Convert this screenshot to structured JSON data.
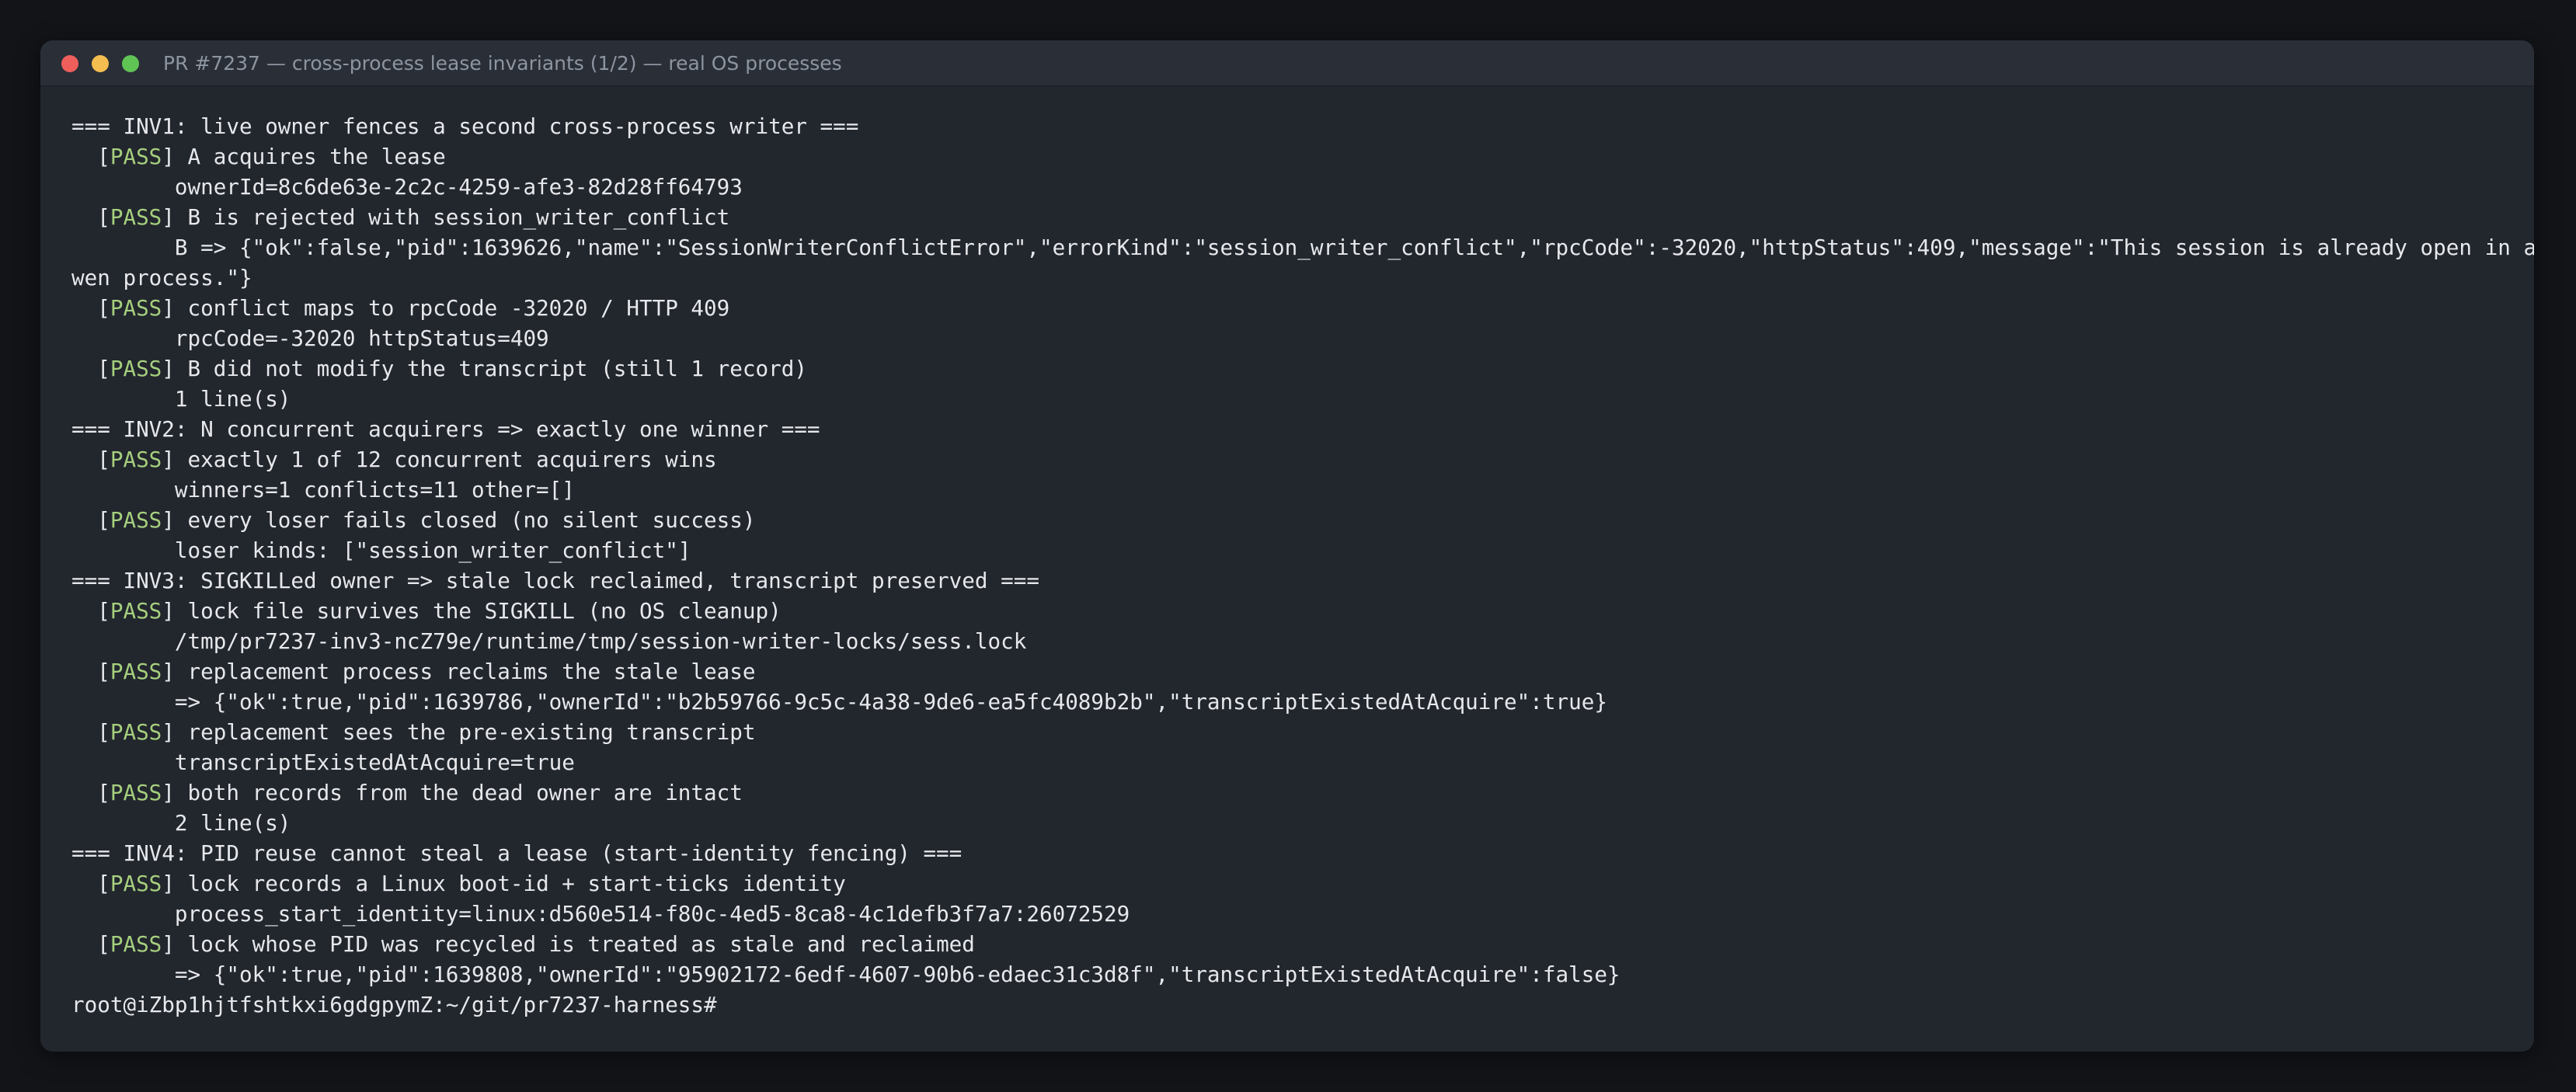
{
  "window": {
    "title": "PR #7237 — cross-process lease invariants (1/2) — real OS processes",
    "colors": {
      "background": "#121418",
      "terminal_bg": "#22262d",
      "titlebar_bg": "#2a2f37",
      "text": "#e6e8eb",
      "pass": "#a6cf7e",
      "traffic_red": "#ee5f5b",
      "traffic_yellow": "#f4bd4f",
      "traffic_green": "#5fc454"
    }
  },
  "terminal": {
    "lines": [
      {
        "text": "=== INV1: live owner fences a second cross-process writer ==="
      },
      {
        "prefix": "  [",
        "status": "PASS",
        "text": "] A acquires the lease"
      },
      {
        "text": "        ownerId=8c6de63e-2c2c-4259-afe3-82d28ff64793"
      },
      {
        "prefix": "  [",
        "status": "PASS",
        "text": "] B is rejected with session_writer_conflict"
      },
      {
        "text": "        B => {\"ok\":false,\"pid\":1639626,\"name\":\"SessionWriterConflictError\",\"errorKind\":\"session_writer_conflict\",\"rpcCode\":-32020,\"httpStatus\":409,\"message\":\"This session is already open in another Q"
      },
      {
        "text": "wen process.\"}"
      },
      {
        "prefix": "  [",
        "status": "PASS",
        "text": "] conflict maps to rpcCode -32020 / HTTP 409"
      },
      {
        "text": "        rpcCode=-32020 httpStatus=409"
      },
      {
        "prefix": "  [",
        "status": "PASS",
        "text": "] B did not modify the transcript (still 1 record)"
      },
      {
        "text": "        1 line(s)"
      },
      {
        "text": "=== INV2: N concurrent acquirers => exactly one winner ==="
      },
      {
        "prefix": "  [",
        "status": "PASS",
        "text": "] exactly 1 of 12 concurrent acquirers wins"
      },
      {
        "text": "        winners=1 conflicts=11 other=[]"
      },
      {
        "prefix": "  [",
        "status": "PASS",
        "text": "] every loser fails closed (no silent success)"
      },
      {
        "text": "        loser kinds: [\"session_writer_conflict\"]"
      },
      {
        "text": "=== INV3: SIGKILLed owner => stale lock reclaimed, transcript preserved ==="
      },
      {
        "prefix": "  [",
        "status": "PASS",
        "text": "] lock file survives the SIGKILL (no OS cleanup)"
      },
      {
        "text": "        /tmp/pr7237-inv3-ncZ79e/runtime/tmp/session-writer-locks/sess.lock"
      },
      {
        "prefix": "  [",
        "status": "PASS",
        "text": "] replacement process reclaims the stale lease"
      },
      {
        "text": "        => {\"ok\":true,\"pid\":1639786,\"ownerId\":\"b2b59766-9c5c-4a38-9de6-ea5fc4089b2b\",\"transcriptExistedAtAcquire\":true}"
      },
      {
        "prefix": "  [",
        "status": "PASS",
        "text": "] replacement sees the pre-existing transcript"
      },
      {
        "text": "        transcriptExistedAtAcquire=true"
      },
      {
        "prefix": "  [",
        "status": "PASS",
        "text": "] both records from the dead owner are intact"
      },
      {
        "text": "        2 line(s)"
      },
      {
        "text": "=== INV4: PID reuse cannot steal a lease (start-identity fencing) ==="
      },
      {
        "prefix": "  [",
        "status": "PASS",
        "text": "] lock records a Linux boot-id + start-ticks identity"
      },
      {
        "text": "        process_start_identity=linux:d560e514-f80c-4ed5-8ca8-4c1defb3f7a7:26072529"
      },
      {
        "prefix": "  [",
        "status": "PASS",
        "text": "] lock whose PID was recycled is treated as stale and reclaimed"
      },
      {
        "text": "        => {\"ok\":true,\"pid\":1639808,\"ownerId\":\"95902172-6edf-4607-90b6-edaec31c3d8f\",\"transcriptExistedAtAcquire\":false}"
      }
    ],
    "prompt": "root@iZbp1hjtfshtkxi6gdgpymZ:~/git/pr7237-harness#"
  }
}
